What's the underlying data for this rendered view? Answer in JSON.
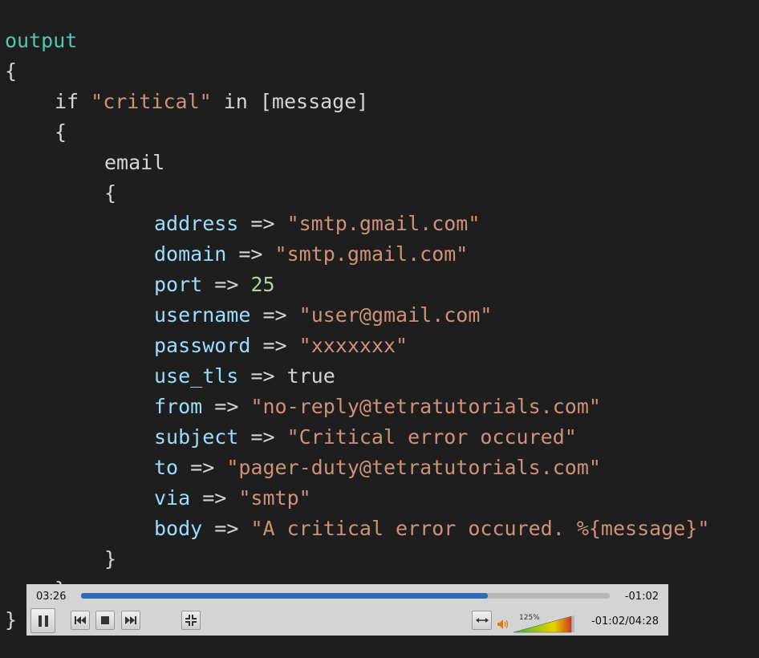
{
  "code": {
    "lines": [
      {
        "indent": 0,
        "tokens": [
          {
            "t": "output",
            "c": "kw-output"
          }
        ]
      },
      {
        "indent": 0,
        "tokens": [
          {
            "t": "{",
            "c": "plain"
          }
        ]
      },
      {
        "indent": 1,
        "tokens": [
          {
            "t": "if ",
            "c": "plain"
          },
          {
            "t": "\"critical\"",
            "c": "str"
          },
          {
            "t": " in [message]",
            "c": "plain"
          }
        ]
      },
      {
        "indent": 1,
        "tokens": [
          {
            "t": "{",
            "c": "plain"
          }
        ]
      },
      {
        "indent": 2,
        "tokens": [
          {
            "t": "email",
            "c": "plain"
          }
        ]
      },
      {
        "indent": 2,
        "tokens": [
          {
            "t": "{",
            "c": "plain"
          }
        ]
      },
      {
        "indent": 3,
        "tokens": [
          {
            "t": "address",
            "c": "key"
          },
          {
            "t": " => ",
            "c": "plain"
          },
          {
            "t": "\"smtp.gmail.com\"",
            "c": "str"
          }
        ]
      },
      {
        "indent": 3,
        "tokens": [
          {
            "t": "domain",
            "c": "key"
          },
          {
            "t": " => ",
            "c": "plain"
          },
          {
            "t": "\"smtp.gmail.com\"",
            "c": "str"
          }
        ]
      },
      {
        "indent": 3,
        "tokens": [
          {
            "t": "port",
            "c": "key"
          },
          {
            "t": " => ",
            "c": "plain"
          },
          {
            "t": "25",
            "c": "num"
          }
        ]
      },
      {
        "indent": 3,
        "tokens": [
          {
            "t": "username",
            "c": "key"
          },
          {
            "t": " => ",
            "c": "plain"
          },
          {
            "t": "\"user@gmail.com\"",
            "c": "str"
          }
        ]
      },
      {
        "indent": 3,
        "tokens": [
          {
            "t": "password",
            "c": "key"
          },
          {
            "t": " => ",
            "c": "plain"
          },
          {
            "t": "\"xxxxxxx\"",
            "c": "str"
          }
        ]
      },
      {
        "indent": 3,
        "tokens": [
          {
            "t": "use_tls",
            "c": "key"
          },
          {
            "t": " => true",
            "c": "plain"
          }
        ]
      },
      {
        "indent": 3,
        "tokens": [
          {
            "t": "from",
            "c": "key"
          },
          {
            "t": " => ",
            "c": "plain"
          },
          {
            "t": "\"no-reply@tetratutorials.com\"",
            "c": "str"
          }
        ]
      },
      {
        "indent": 3,
        "tokens": [
          {
            "t": "subject",
            "c": "key"
          },
          {
            "t": " => ",
            "c": "plain"
          },
          {
            "t": "\"Critical error occured\"",
            "c": "str"
          }
        ]
      },
      {
        "indent": 3,
        "tokens": [
          {
            "t": "to",
            "c": "key"
          },
          {
            "t": " => ",
            "c": "plain"
          },
          {
            "t": "\"pager-duty@tetratutorials.com\"",
            "c": "str"
          }
        ]
      },
      {
        "indent": 3,
        "tokens": [
          {
            "t": "via",
            "c": "key"
          },
          {
            "t": " => ",
            "c": "plain"
          },
          {
            "t": "\"smtp\"",
            "c": "str"
          }
        ]
      },
      {
        "indent": 3,
        "tokens": [
          {
            "t": "body",
            "c": "key"
          },
          {
            "t": " => ",
            "c": "plain"
          },
          {
            "t": "\"A critical error occured. %{message}\"",
            "c": "str"
          }
        ]
      },
      {
        "indent": 2,
        "tokens": [
          {
            "t": "}",
            "c": "plain"
          }
        ]
      },
      {
        "indent": 1,
        "tokens": [
          {
            "t": "}",
            "c": "plain"
          }
        ]
      },
      {
        "indent": 0,
        "tokens": [
          {
            "t": "}",
            "c": "plain"
          }
        ]
      }
    ]
  },
  "player": {
    "time_elapsed": "03:26",
    "time_remaining": "-01:02",
    "time_total": "-01:02/04:28",
    "progress_fraction": 0.77,
    "volume_label": "125%",
    "colors": {
      "seek_fill": "#2e6db6",
      "background": "#d4d4d4"
    },
    "icons": [
      "pause-icon",
      "skip-previous-icon",
      "stop-icon",
      "skip-next-icon",
      "fullscreen-exit-icon",
      "aspect-ratio-icon",
      "speaker-icon",
      "volume-slider"
    ]
  }
}
